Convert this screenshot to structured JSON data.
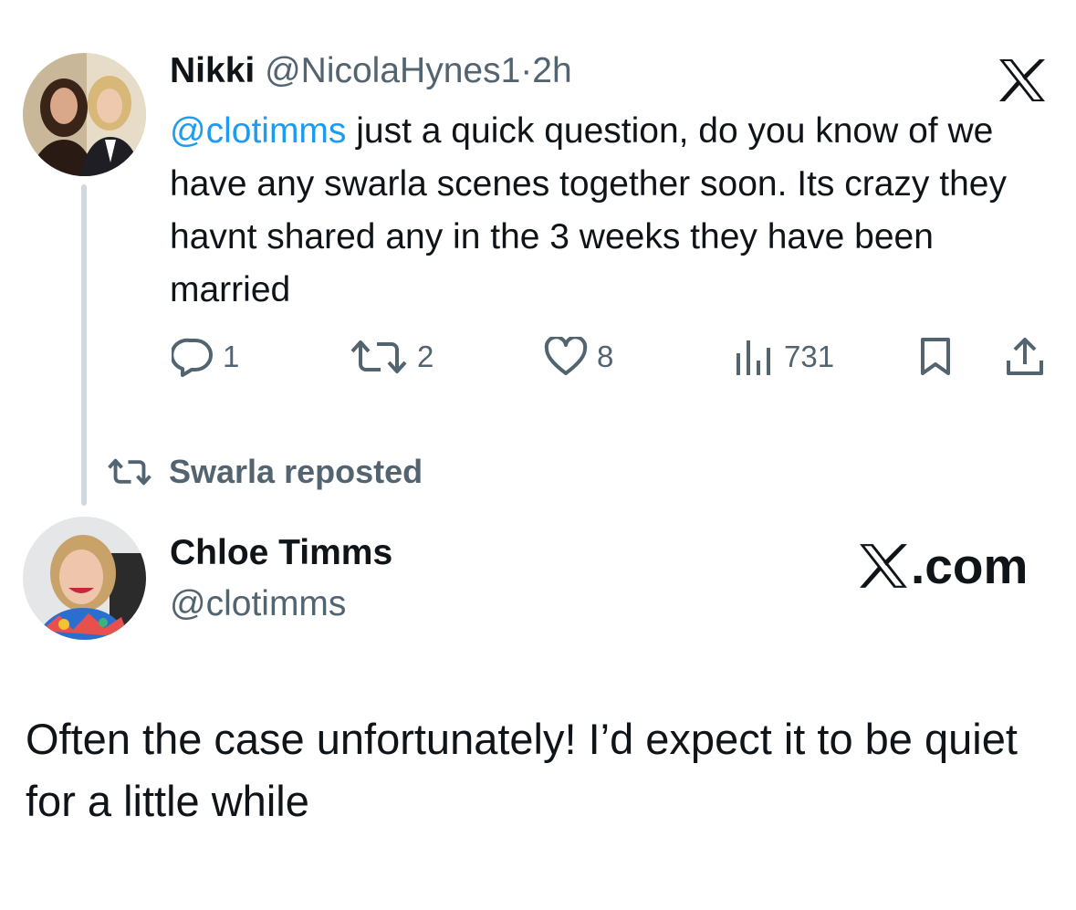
{
  "tweet": {
    "author_name": "Nikki",
    "author_handle": "@NicolaHynes1",
    "separator": "·",
    "time": "2h",
    "mention": "@clotimms",
    "text": " just a quick question, do you know of we have any swarla scenes together soon. Its crazy they havnt shared any in the 3 weeks they have been married",
    "stats": {
      "replies": "1",
      "reposts": "2",
      "likes": "8",
      "views": "731"
    }
  },
  "repost_banner": {
    "label": "Swarla reposted"
  },
  "reply": {
    "author_name": "Chloe Timms",
    "author_handle": "@clotimms",
    "brand": ".com",
    "text": "Often the case unfortunately! I’d expect it to be quiet for a little while"
  },
  "icons": {
    "top_logo": "x-logo-icon",
    "reply": "reply-bubble-icon",
    "repost": "repost-icon",
    "like": "heart-icon",
    "views": "views-chart-icon",
    "bookmark": "bookmark-icon",
    "share": "share-icon"
  },
  "colors": {
    "text": "#0f1419",
    "secondary": "#536471",
    "link": "#1d9bf0",
    "thread_line": "#cfd9de"
  }
}
